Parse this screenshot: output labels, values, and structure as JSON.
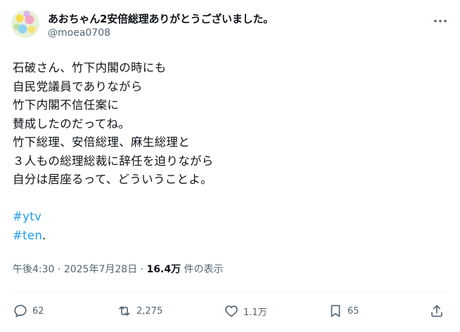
{
  "author": {
    "name": "あおちゃん2安倍総理ありがとうございました。",
    "handle": "@moea0708"
  },
  "tweet": {
    "lines": [
      "石破さん、竹下内閣の時にも",
      "自民党議員でありながら",
      "竹下内閣不信任案に",
      "賛成したのだってね。",
      "竹下総理、安倍総理、麻生総理と",
      "３人もの総理総裁に辞任を迫りながら",
      "自分は居座るって、どういうことよ。"
    ],
    "hashtags": [
      "#ytv",
      "#ten"
    ],
    "trailing_period": "."
  },
  "meta": {
    "time": "午後4:30",
    "separator": "·",
    "date": "2025年7月28日",
    "views_count": "16.4万",
    "views_label": "件の表示"
  },
  "actions": {
    "reply_count": "62",
    "retweet_count": "2,275",
    "like_count": "1.1万",
    "bookmark_count": "65"
  },
  "icons": {
    "more": "more-dots-icon",
    "reply": "reply-bubble-icon",
    "retweet": "retweet-icon",
    "like": "heart-icon",
    "bookmark": "bookmark-icon",
    "share": "share-upload-icon"
  },
  "colors": {
    "text": "#0f1419",
    "secondary": "#536471",
    "link": "#1d9bf0",
    "divider": "#eff3f4"
  }
}
